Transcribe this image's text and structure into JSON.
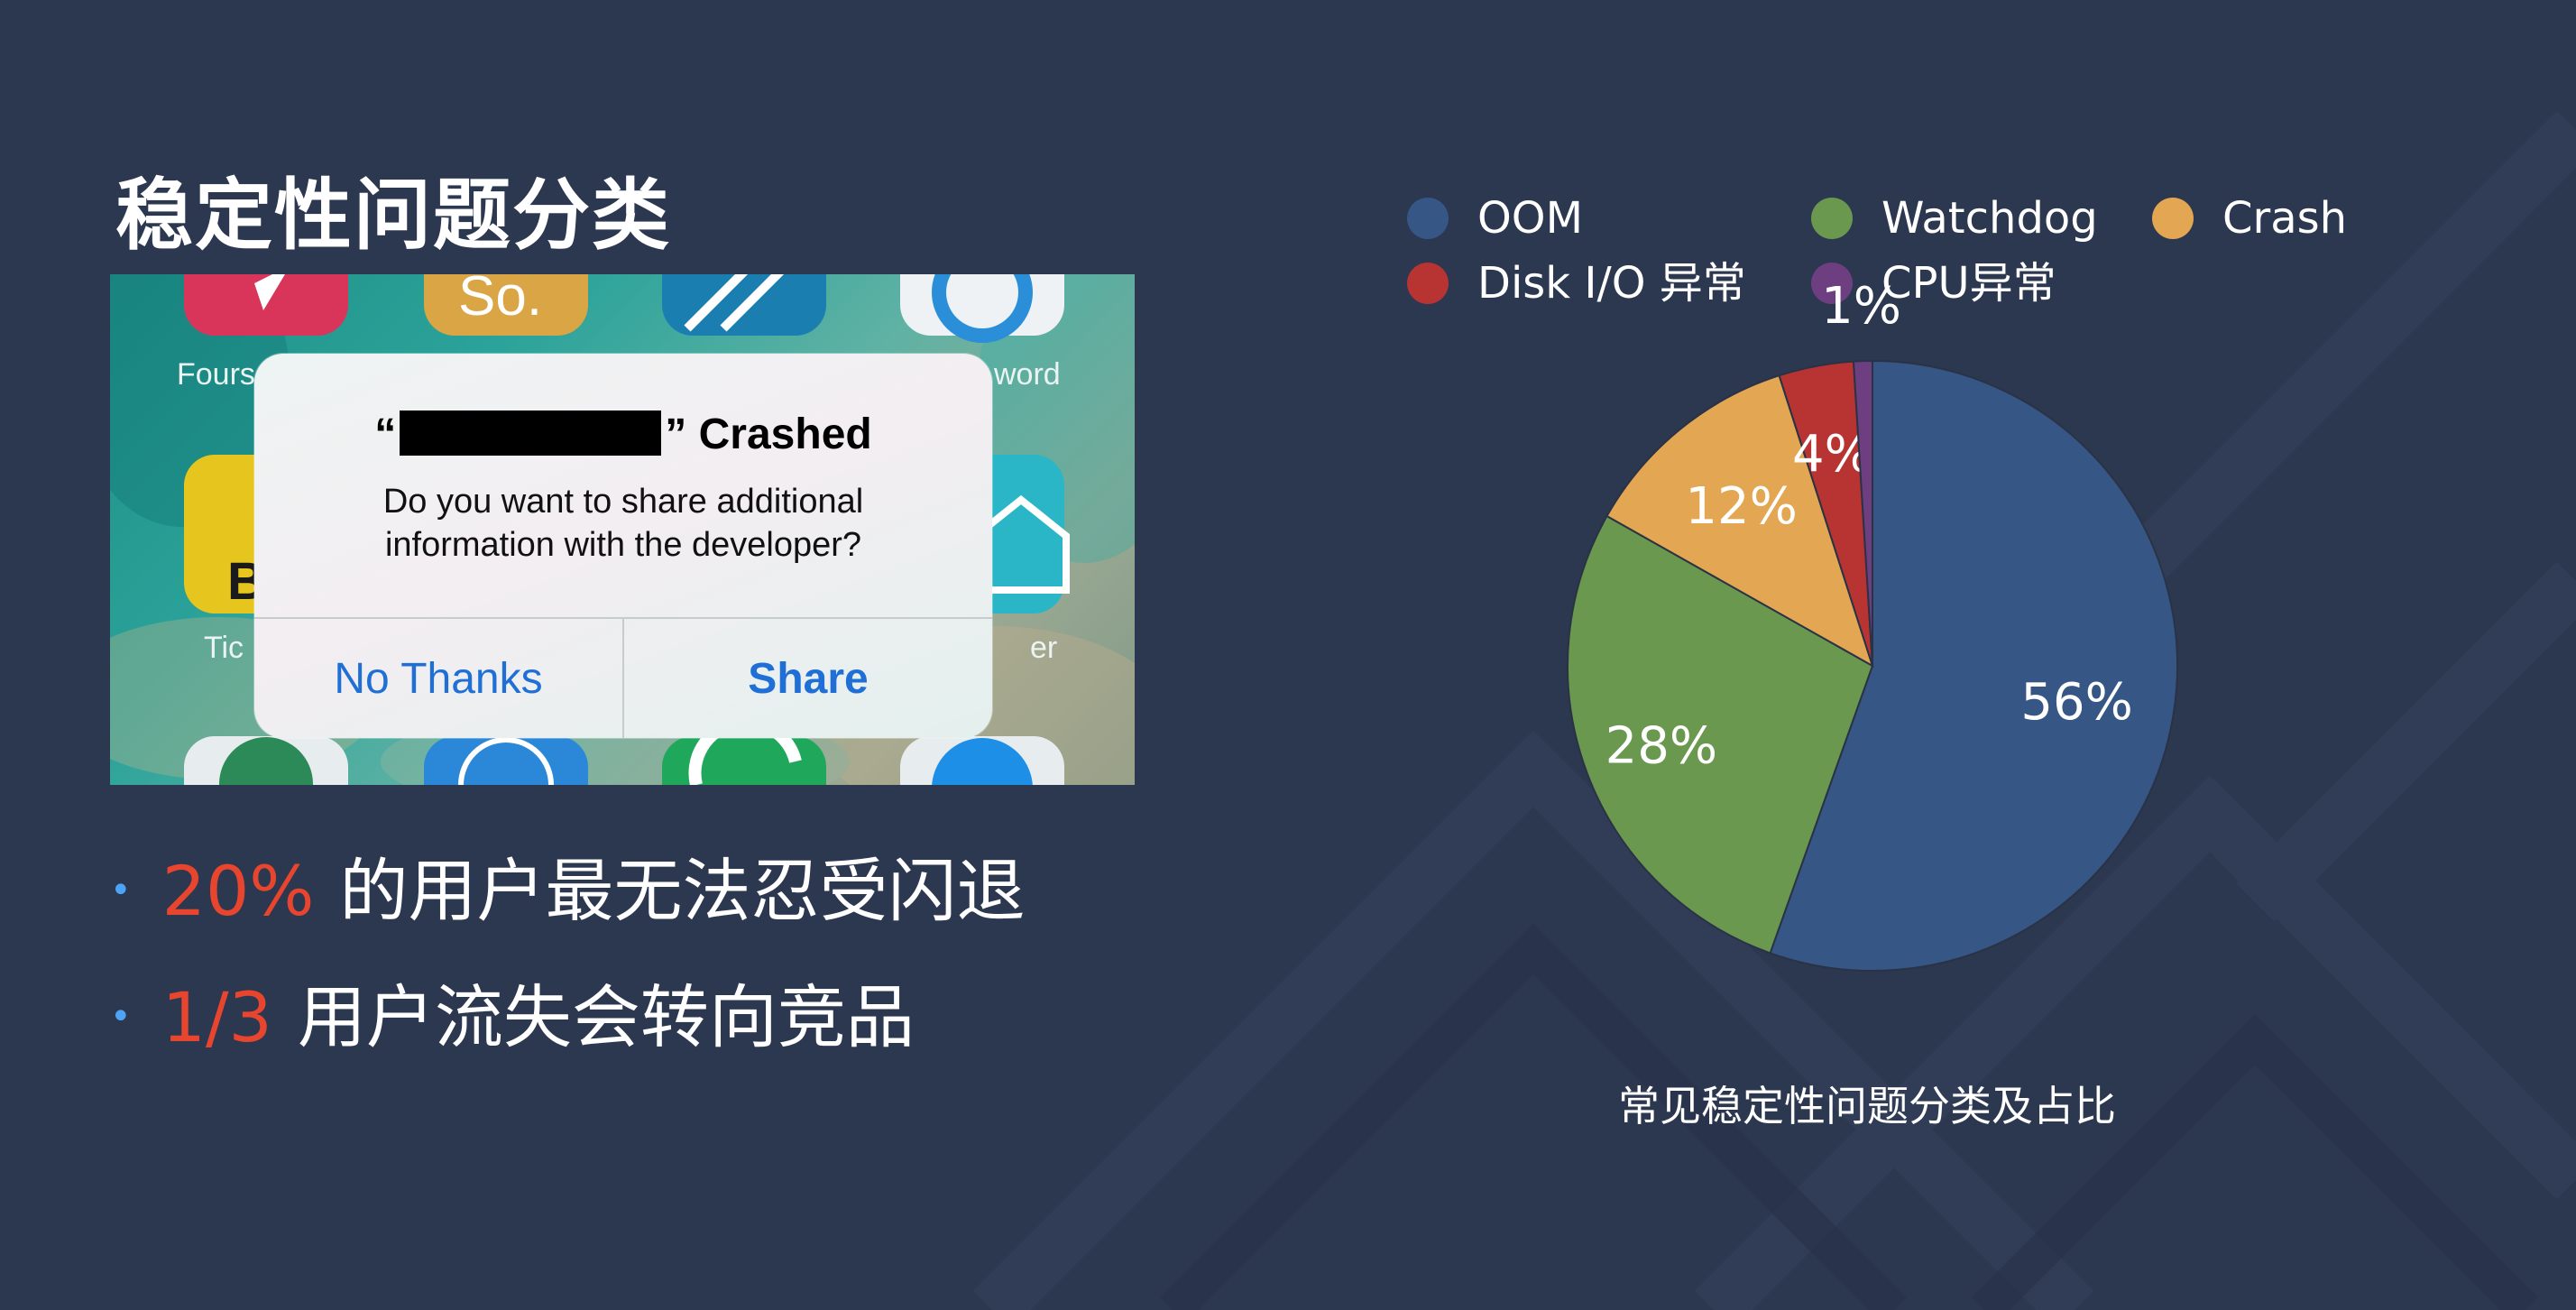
{
  "slide": {
    "title": "稳定性问题分类",
    "colors": {
      "background": "#2c3750",
      "highlight": "#e8452f",
      "bullet_dot": "#4da3f5"
    }
  },
  "screenshot": {
    "bg_labels": {
      "foursquare": "Fours",
      "password": "word",
      "tickets": "Tic",
      "other": "er",
      "b_letter": "B",
      "so_text": "So."
    },
    "alert": {
      "title_open": "“",
      "title_close": "” Crashed",
      "message": "Do you want to share additional information with the developer?",
      "buttons": {
        "cancel": "No Thanks",
        "confirm": "Share"
      }
    }
  },
  "bullets": [
    {
      "marker": "•",
      "highlight": "20%",
      "text": "的用户最无法忍受闪退"
    },
    {
      "marker": "•",
      "highlight": "1/3",
      "text": "用户流失会转向竞品"
    }
  ],
  "chart_data": {
    "type": "pie",
    "title": "常见稳定性问题分类及占比",
    "legend_position": "top",
    "slices": [
      {
        "name": "OOM",
        "value": 56,
        "label": "56%",
        "color": "#365686"
      },
      {
        "name": "Watchdog",
        "value": 28,
        "label": "28%",
        "color": "#6a984f"
      },
      {
        "name": "Crash",
        "value": 12,
        "label": "12%",
        "color": "#e3a652"
      },
      {
        "name": "Disk I/O 异常",
        "value": 4,
        "label": "4%",
        "color": "#b73432"
      },
      {
        "name": "CPU异常",
        "value": 1,
        "label": "1%",
        "color": "#6e3f80"
      }
    ]
  }
}
